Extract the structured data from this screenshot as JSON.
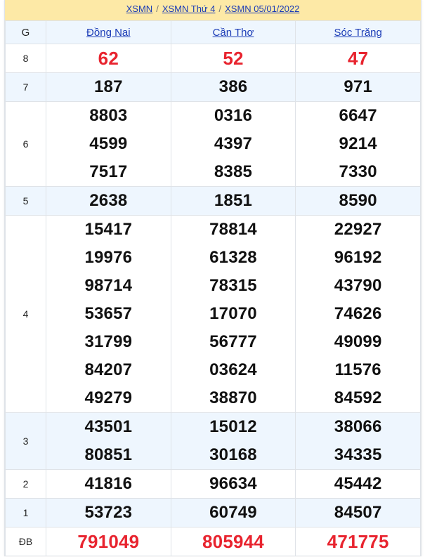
{
  "breadcrumb": [
    {
      "label": "XSMN"
    },
    {
      "label": "XSMN Thứ 4"
    },
    {
      "label": "XSMN 05/01/2022"
    }
  ],
  "breadcrumb_separator": "/",
  "table": {
    "header": {
      "prize_col": "G",
      "provinces": [
        "Đồng Nai",
        "Cần Thơ",
        "Sóc Trăng"
      ]
    },
    "rows": [
      {
        "prize": "8",
        "highlight": true,
        "values": [
          [
            "62"
          ],
          [
            "52"
          ],
          [
            "47"
          ]
        ]
      },
      {
        "prize": "7",
        "values": [
          [
            "187"
          ],
          [
            "386"
          ],
          [
            "971"
          ]
        ]
      },
      {
        "prize": "6",
        "values": [
          [
            "8803",
            "4599",
            "7517"
          ],
          [
            "0316",
            "4397",
            "8385"
          ],
          [
            "6647",
            "9214",
            "7330"
          ]
        ]
      },
      {
        "prize": "5",
        "values": [
          [
            "2638"
          ],
          [
            "1851"
          ],
          [
            "8590"
          ]
        ]
      },
      {
        "prize": "4",
        "values": [
          [
            "15417",
            "19976",
            "98714",
            "53657",
            "31799",
            "84207",
            "49279"
          ],
          [
            "78814",
            "61328",
            "78315",
            "17070",
            "56777",
            "03624",
            "38870"
          ],
          [
            "22927",
            "96192",
            "43790",
            "74626",
            "49099",
            "11576",
            "84592"
          ]
        ]
      },
      {
        "prize": "3",
        "values": [
          [
            "43501",
            "80851"
          ],
          [
            "15012",
            "30168"
          ],
          [
            "38066",
            "34335"
          ]
        ]
      },
      {
        "prize": "2",
        "values": [
          [
            "41816"
          ],
          [
            "96634"
          ],
          [
            "45442"
          ]
        ]
      },
      {
        "prize": "1",
        "values": [
          [
            "53723"
          ],
          [
            "60749"
          ],
          [
            "84507"
          ]
        ]
      },
      {
        "prize": "ĐB",
        "highlight": true,
        "values": [
          [
            "791049"
          ],
          [
            "805944"
          ],
          [
            "471775"
          ]
        ]
      }
    ]
  },
  "colors": {
    "highlight_number": "#e8242f",
    "link": "#1a3bb6",
    "breadcrumb_bg": "#fde9a6",
    "alt_row_bg": "#eef6fe"
  }
}
